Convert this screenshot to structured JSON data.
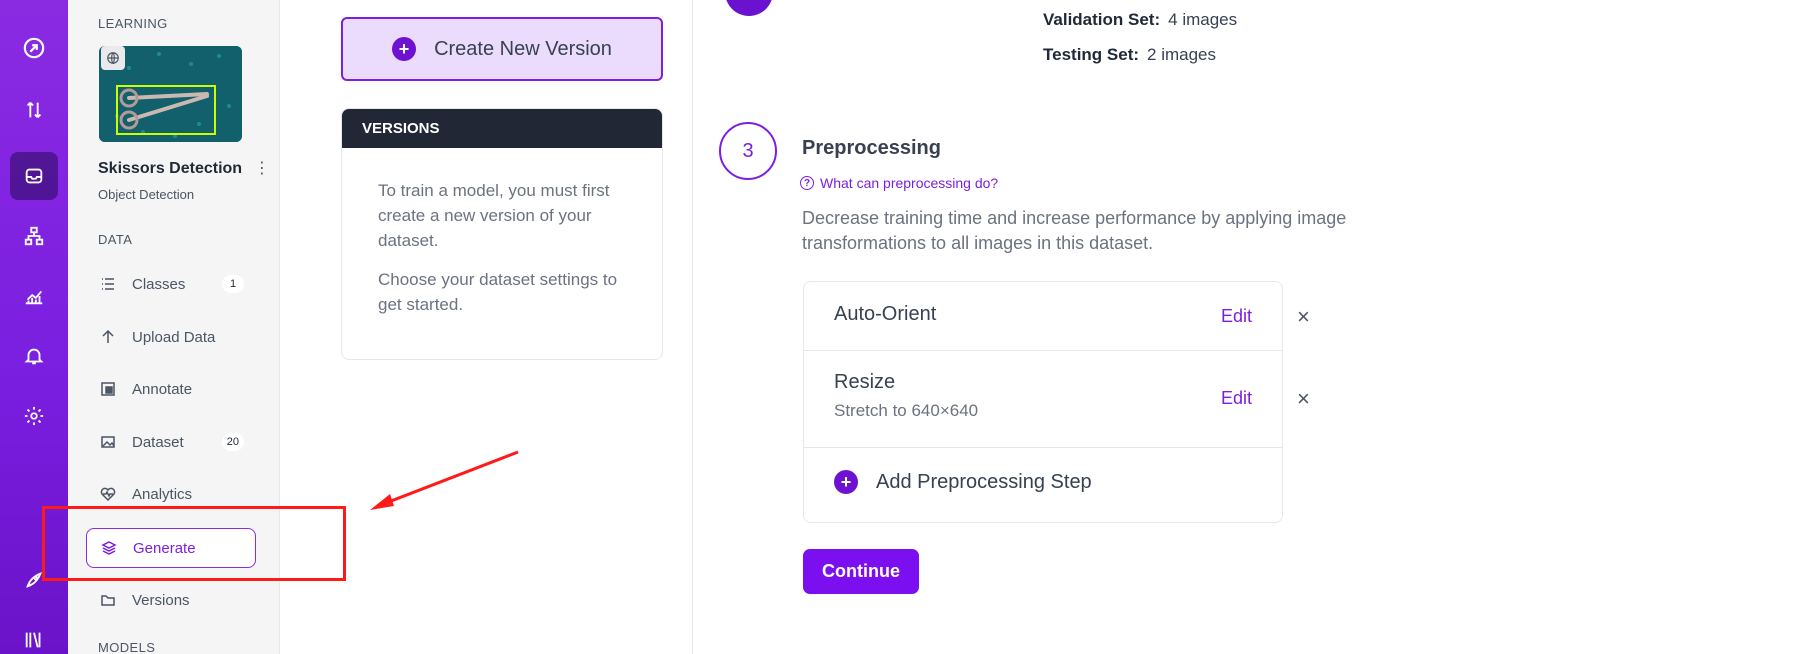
{
  "rail": {
    "icons": [
      "roboflow-logo-icon",
      "transfer-icon",
      "inbox-icon",
      "workflows-icon",
      "analytics-icon",
      "bell-icon",
      "gear-icon",
      "rocket-icon",
      "library-icon"
    ]
  },
  "sidebar": {
    "workspace_label": "LEARNING",
    "project_name": "Skissors Detection",
    "project_type": "Object Detection",
    "data_label": "DATA",
    "models_label": "MODELS",
    "items": [
      {
        "label": "Classes",
        "badge": "1"
      },
      {
        "label": "Upload Data"
      },
      {
        "label": "Annotate"
      },
      {
        "label": "Dataset",
        "badge": "20"
      },
      {
        "label": "Analytics"
      },
      {
        "label": "Generate"
      },
      {
        "label": "Versions"
      }
    ]
  },
  "middle": {
    "create_label": "Create New Version",
    "versions_header": "VERSIONS",
    "versions_text_1": "To train a model, you must first create a new version of your dataset.",
    "versions_text_2": "Choose your dataset settings to get started."
  },
  "splits": {
    "validation_label": "Validation Set:",
    "validation_value": "4 images",
    "testing_label": "Testing Set:",
    "testing_value": "2 images"
  },
  "step": {
    "number": "3",
    "title": "Preprocessing",
    "help_link": "What can preprocessing do?",
    "description": "Decrease training time and increase performance by applying image transformations to all images in this dataset.",
    "rows": [
      {
        "name": "Auto-Orient",
        "sub": "",
        "edit": "Edit"
      },
      {
        "name": "Resize",
        "sub": "Stretch to 640×640",
        "edit": "Edit"
      }
    ],
    "add_label": "Add Preprocessing Step",
    "continue_label": "Continue"
  },
  "colors": {
    "brand": "#7b1fe0",
    "annotation": "#ff1a1a"
  }
}
